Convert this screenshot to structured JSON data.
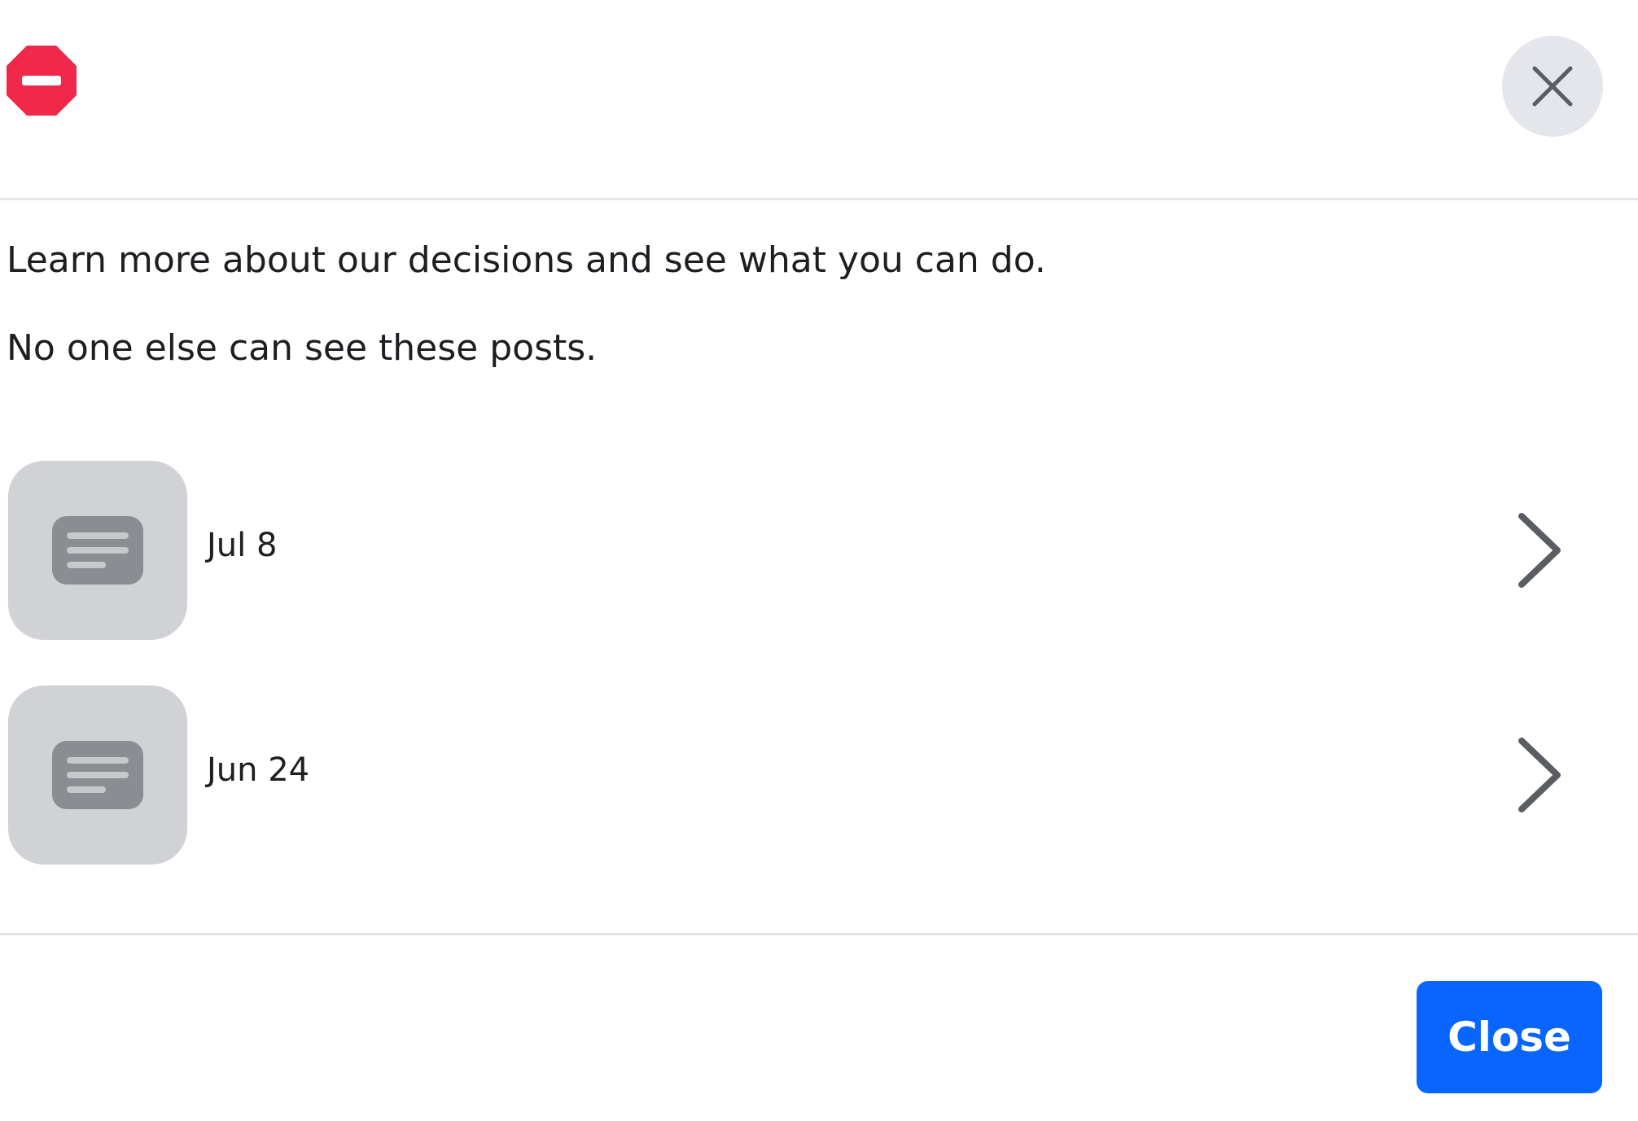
{
  "header": {
    "status_icon": "blocked-icon",
    "status_color": "#f02849",
    "close_icon": "close-icon"
  },
  "body": {
    "paragraph_1": "Learn more about our decisions and see what you can do.",
    "paragraph_2": "No one else can see these posts."
  },
  "posts": [
    {
      "date": "Jul 8",
      "icon": "post-text-icon",
      "action_icon": "chevron-right-icon"
    },
    {
      "date": "Jun 24",
      "icon": "post-text-icon",
      "action_icon": "chevron-right-icon"
    }
  ],
  "footer": {
    "close_label": "Close",
    "button_color": "#0866ff"
  }
}
